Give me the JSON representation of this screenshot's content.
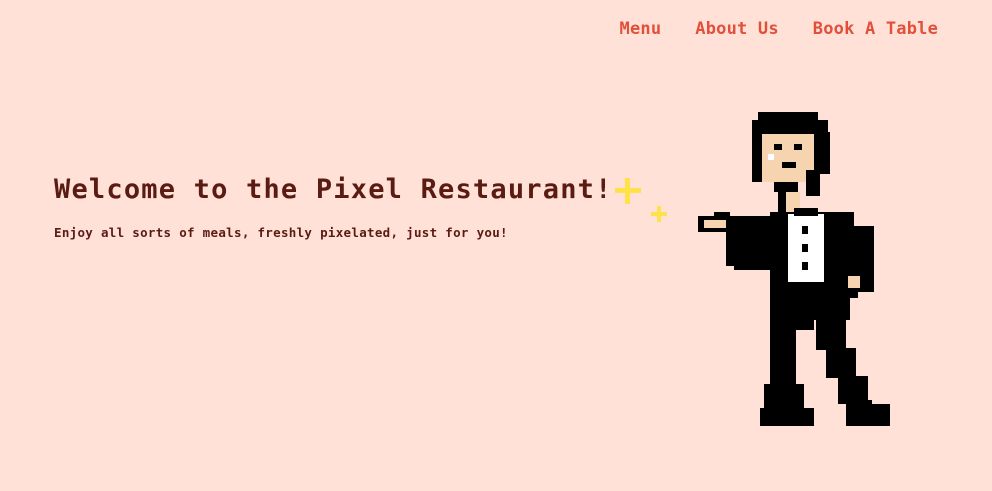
{
  "nav": {
    "items": [
      {
        "label": "Menu"
      },
      {
        "label": "About Us"
      },
      {
        "label": "Book A Table"
      }
    ]
  },
  "hero": {
    "title": "Welcome to the Pixel Restaurant!",
    "subtitle": "Enjoy all sorts of meals, freshly pixelated, just for you!"
  },
  "illustration": {
    "icon": "pixel-waiter-icon",
    "sparkle_icon": "sparkle-icon"
  },
  "colors": {
    "background": "#ffe1d7",
    "nav_link": "#e2503a",
    "heading": "#5a1b12",
    "sparkle": "#ffe14a",
    "skin": "#f6d4b0",
    "hair_suit": "#000000",
    "shirt": "#ffffff"
  }
}
